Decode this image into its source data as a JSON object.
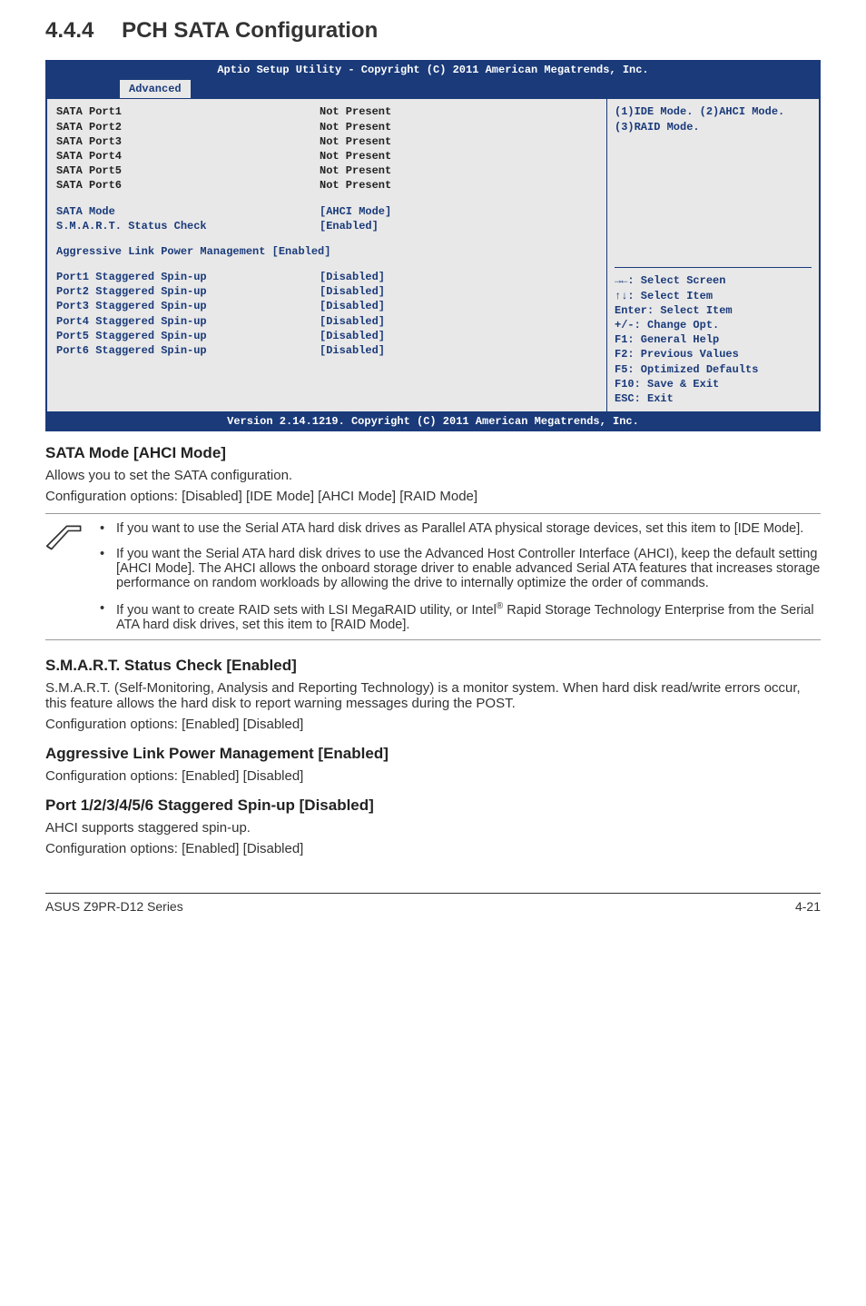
{
  "heading": {
    "number": "4.4.4",
    "title": "PCH SATA Configuration"
  },
  "bios": {
    "title": "Aptio Setup Utility - Copyright (C) 2011 American Megatrends, Inc.",
    "tab": "Advanced",
    "rows_static": [
      {
        "label": "SATA Port1",
        "value": "Not Present"
      },
      {
        "label": "SATA Port2",
        "value": "Not Present"
      },
      {
        "label": "SATA Port3",
        "value": "Not Present"
      },
      {
        "label": "SATA Port4",
        "value": "Not Present"
      },
      {
        "label": "SATA Port5",
        "value": "Not Present"
      },
      {
        "label": "SATA Port6",
        "value": "Not Present"
      }
    ],
    "mode_rows": [
      {
        "label": "SATA Mode",
        "value": "[AHCI Mode]"
      },
      {
        "label": "S.M.A.R.T. Status Check",
        "value": "[Enabled]"
      }
    ],
    "aggressive": "Aggressive Link Power Management [Enabled]",
    "spinup_rows": [
      {
        "label": "Port1 Staggered Spin-up",
        "value": "[Disabled]"
      },
      {
        "label": "Port2 Staggered Spin-up",
        "value": "[Disabled]"
      },
      {
        "label": "Port3 Staggered Spin-up",
        "value": "[Disabled]"
      },
      {
        "label": "Port4 Staggered Spin-up",
        "value": "[Disabled]"
      },
      {
        "label": "Port5 Staggered Spin-up",
        "value": "[Disabled]"
      },
      {
        "label": "Port6 Staggered Spin-up",
        "value": "[Disabled]"
      }
    ],
    "help_top": "(1)IDE Mode. (2)AHCI Mode.\n(3)RAID Mode.",
    "help_nav": [
      "→←: Select Screen",
      "↑↓:  Select Item",
      "Enter: Select Item",
      "+/-: Change Opt.",
      "F1: General Help",
      "F2: Previous Values",
      "F5: Optimized Defaults",
      "F10: Save & Exit",
      "ESC: Exit"
    ],
    "footer": "Version 2.14.1219. Copyright (C) 2011 American Megatrends, Inc."
  },
  "sections": {
    "sata_mode": {
      "title": "SATA Mode [AHCI Mode]",
      "p1": "Allows you to set the SATA configuration.",
      "p2": "Configuration options: [Disabled] [IDE Mode] [AHCI Mode] [RAID Mode]"
    },
    "notes": {
      "n1": "If you want to use the Serial ATA hard disk drives as Parallel ATA physical storage devices, set this item to [IDE Mode].",
      "n2": "If you want the Serial ATA hard disk drives to use the Advanced Host Controller Interface (AHCI), keep the default setting [AHCI Mode]. The AHCI allows the onboard storage driver to enable advanced Serial ATA features that increases storage performance on random workloads by allowing the drive to internally optimize the order of commands.",
      "n3a": "If you want to create RAID sets with LSI MegaRAID utility, or Intel",
      "n3b": " Rapid Storage Technology Enterprise from the Serial ATA hard disk drives, set this item to [RAID Mode]."
    },
    "smart": {
      "title": "S.M.A.R.T. Status Check [Enabled]",
      "p1": "S.M.A.R.T. (Self-Monitoring, Analysis and Reporting Technology) is a monitor system. When hard disk read/write errors occur, this feature allows the hard disk to report warning messages during the POST.",
      "p2": "Configuration options: [Enabled] [Disabled]"
    },
    "aggressive": {
      "title": "Aggressive Link Power Management [Enabled]",
      "p1": "Configuration options: [Enabled] [Disabled]"
    },
    "staggered": {
      "title": "Port 1/2/3/4/5/6 Staggered Spin-up [Disabled]",
      "p1": "AHCI supports staggered spin-up.",
      "p2": "Configuration options: [Enabled] [Disabled]"
    }
  },
  "footer": {
    "left": "ASUS Z9PR-D12 Series",
    "right": "4-21"
  }
}
